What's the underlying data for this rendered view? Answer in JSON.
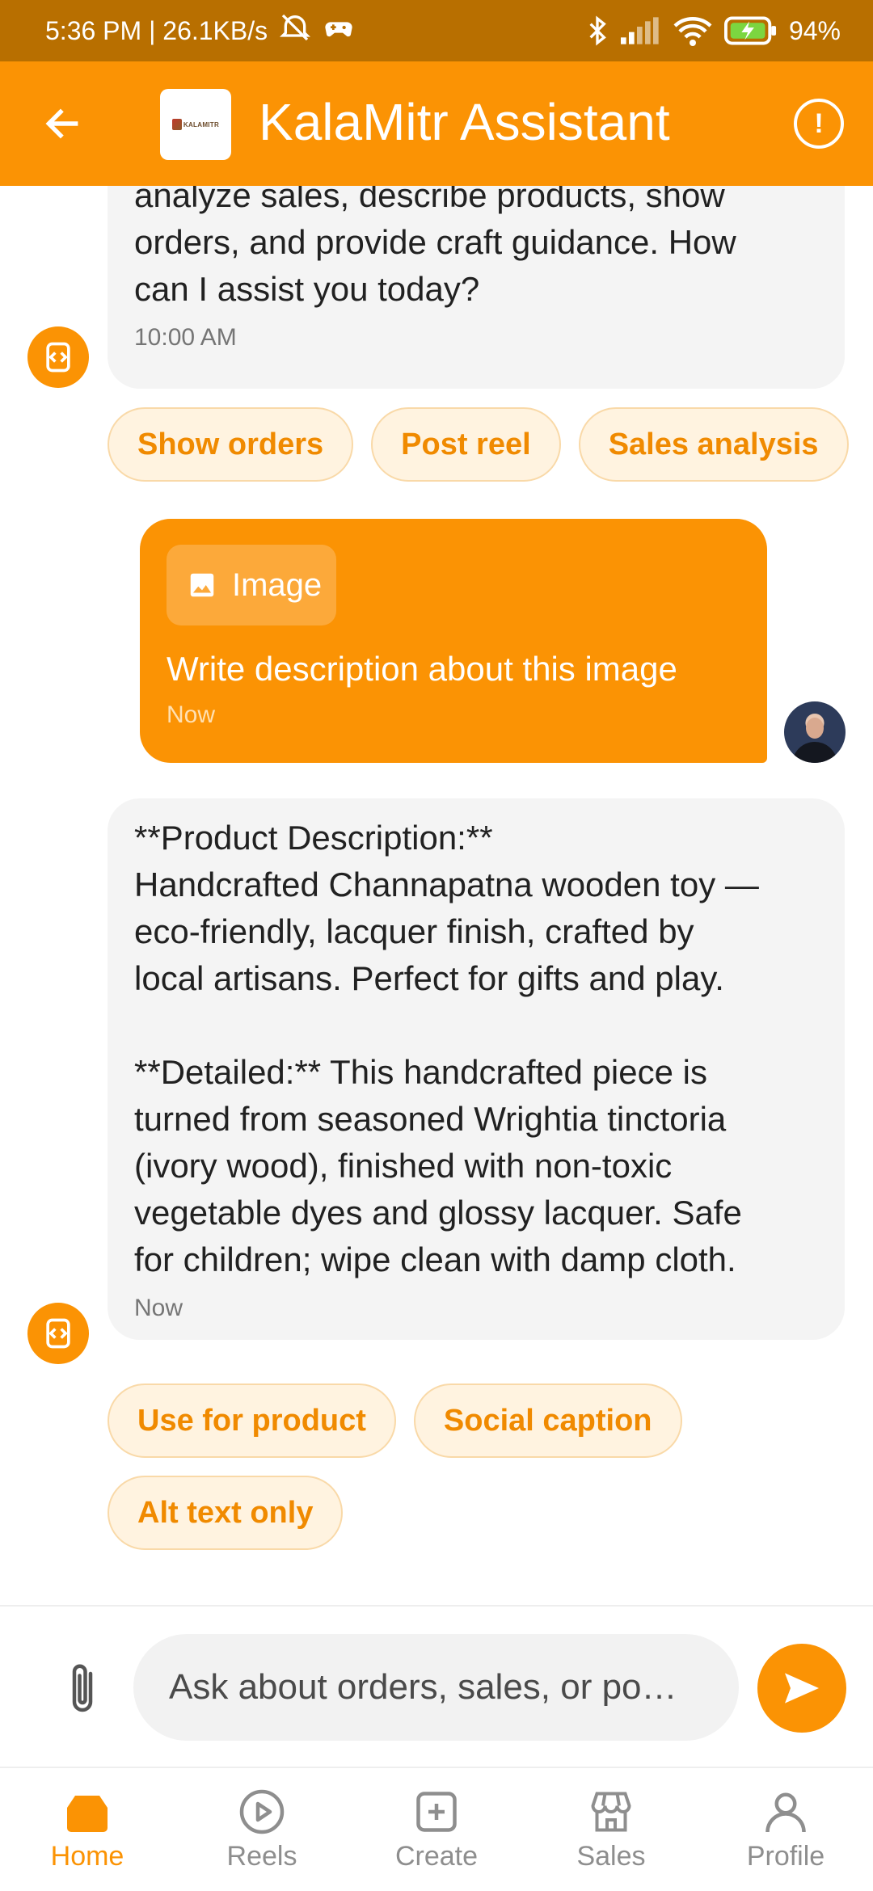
{
  "status_bar": {
    "left_text": "5:36 PM | 26.1KB/s",
    "battery": "94%",
    "icons": [
      "alarm-off-icon",
      "game-controller-icon",
      "bluetooth-icon",
      "signal-icon",
      "wifi-icon",
      "battery-charging-icon"
    ]
  },
  "app_bar": {
    "title": "KalaMitr Assistant",
    "logo_text": "KALAMITR",
    "back_icon": "arrow-left-icon",
    "info_icon": "info-icon",
    "info_glyph": "!"
  },
  "messages": {
    "bot1": {
      "text": "analyze sales, describe products, show\norders, and provide craft guidance. How\ncan I assist you today?",
      "time": "10:00 AM"
    },
    "chips1": [
      "Show orders",
      "Post reel",
      "Sales analysis"
    ],
    "user1": {
      "attachment_label": "Image",
      "text": "Write description about this image",
      "time": "Now"
    },
    "bot2": {
      "text": "**Product Description:**\nHandcrafted Channapatna wooden toy —\neco-friendly, lacquer finish, crafted by\nlocal artisans. Perfect for gifts and play.\n\n**Detailed:** This handcrafted piece is\nturned from seasoned Wrightia tinctoria\n(ivory wood), finished with non-toxic\nvegetable dyes and glossy lacquer. Safe\nfor children; wipe clean with damp cloth.",
      "time": "Now"
    },
    "chips2": [
      "Use for product",
      "Social caption",
      "Alt text only"
    ]
  },
  "input": {
    "placeholder": "Ask about orders, sales, or po…"
  },
  "nav": [
    {
      "label": "Home",
      "icon": "home-icon",
      "active": true
    },
    {
      "label": "Reels",
      "icon": "play-circle-icon",
      "active": false
    },
    {
      "label": "Create",
      "icon": "add-box-icon",
      "active": false
    },
    {
      "label": "Sales",
      "icon": "storefront-icon",
      "active": false
    },
    {
      "label": "Profile",
      "icon": "person-icon",
      "active": false
    }
  ],
  "colors": {
    "accent": "#FB9304",
    "status_bar": "#B86F00",
    "chip_bg": "#FFF3E0",
    "chip_text": "#F08A00",
    "bot_bubble": "#F4F4F4"
  }
}
